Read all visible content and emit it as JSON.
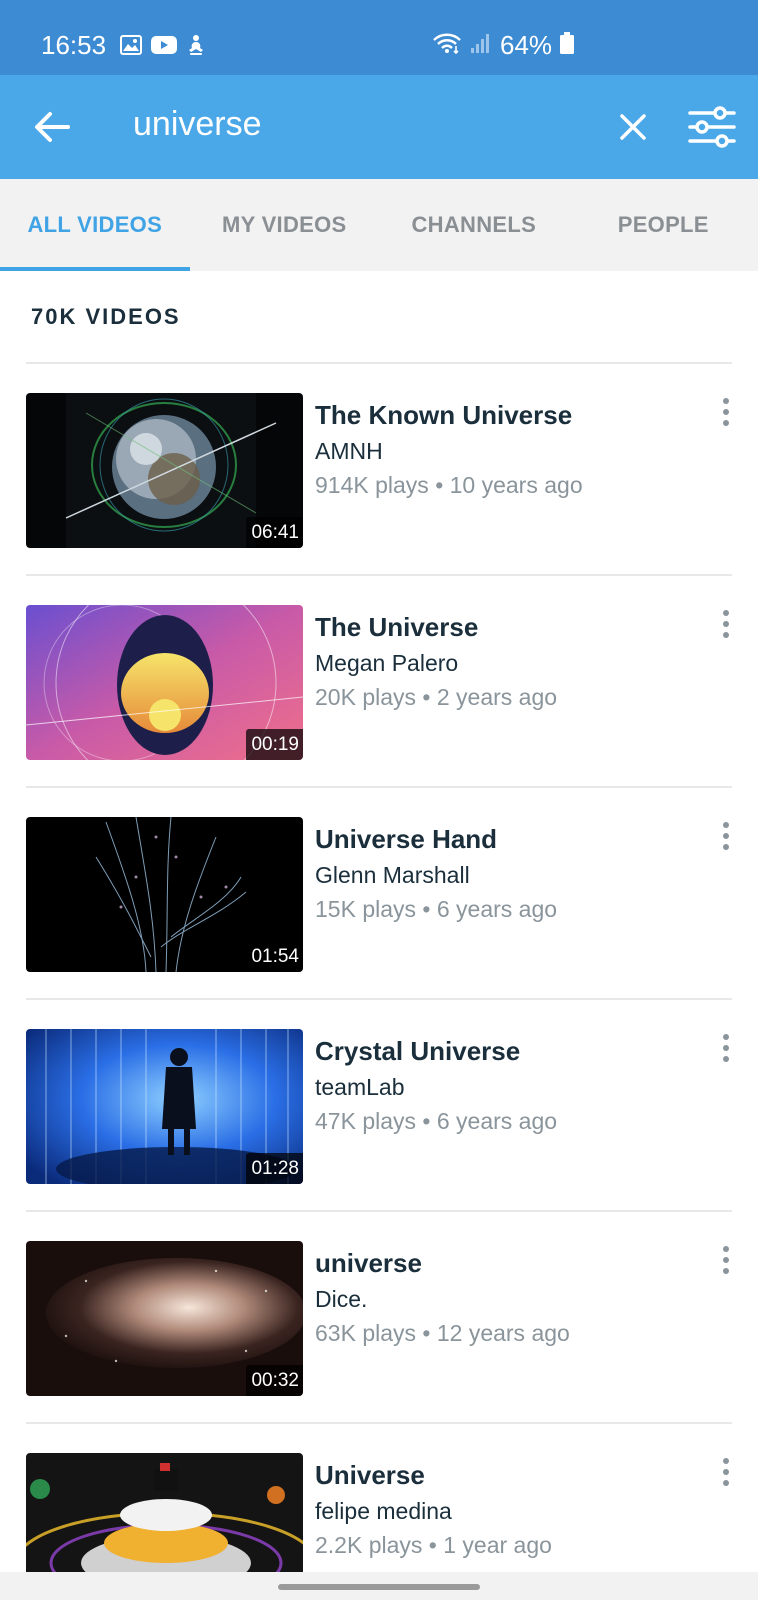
{
  "status_bar": {
    "time": "16:53",
    "battery": "64%",
    "icons": [
      "gallery-icon",
      "youtube-icon",
      "meditation-icon",
      "wifi-icon",
      "signal-icon",
      "battery-icon"
    ]
  },
  "search": {
    "query": "universe",
    "icons": [
      "back-arrow-icon",
      "close-icon",
      "filter-sliders-icon"
    ]
  },
  "tabs": [
    {
      "label": "ALL VIDEOS",
      "active": true
    },
    {
      "label": "MY VIDEOS",
      "active": false
    },
    {
      "label": "CHANNELS",
      "active": false
    },
    {
      "label": "PEOPLE",
      "active": false
    }
  ],
  "results": {
    "count_label": "70K VIDEOS",
    "videos": [
      {
        "title": "The Known Universe",
        "author": "AMNH",
        "meta": "914K plays • 10 years ago",
        "duration": "06:41"
      },
      {
        "title": "The Universe",
        "author": "Megan Palero",
        "meta": "20K plays • 2 years ago",
        "duration": "00:19"
      },
      {
        "title": "Universe Hand",
        "author": "Glenn Marshall",
        "meta": "15K plays • 6 years ago",
        "duration": "01:54"
      },
      {
        "title": "Crystal Universe",
        "author": "teamLab",
        "meta": "47K plays • 6 years ago",
        "duration": "01:28"
      },
      {
        "title": "universe",
        "author": "Dice.",
        "meta": "63K plays • 12 years ago",
        "duration": "00:32"
      },
      {
        "title": "Universe",
        "author": "felipe medina",
        "meta": "2.2K plays • 1 year ago",
        "duration": ""
      }
    ]
  },
  "colors": {
    "status_bar": "#3d8bd2",
    "search_bar": "#4aa8e8",
    "accent": "#3fa3e6",
    "text_primary": "#1a2e3b",
    "text_secondary": "#8a949b"
  }
}
